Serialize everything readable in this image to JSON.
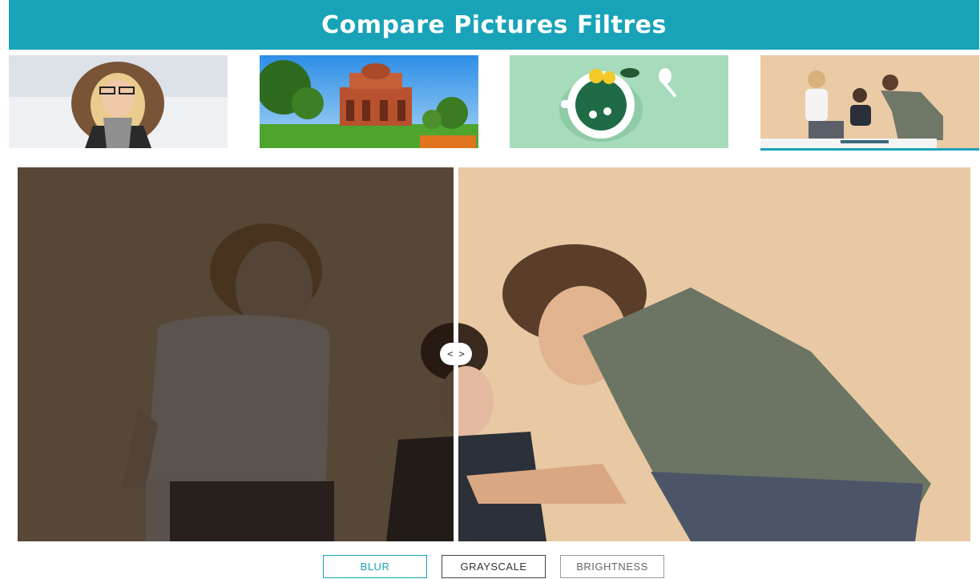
{
  "header": {
    "title": "Compare Pictures Filtres"
  },
  "colors": {
    "accent": "#18a3b8"
  },
  "thumbnails": [
    {
      "name": "woman-in-fur-hood",
      "selected": false
    },
    {
      "name": "red-stone-monument",
      "selected": false
    },
    {
      "name": "tea-cup-illustration",
      "selected": false
    },
    {
      "name": "team-working-at-laptop",
      "selected": true
    }
  ],
  "viewer": {
    "handle_icon": "arrows-left-right-icon",
    "handle_glyph": "< >"
  },
  "filters": {
    "blur": "BLUR",
    "grayscale": "GRAYSCALE",
    "brightness": "BRIGHTNESS",
    "active": "blur"
  }
}
